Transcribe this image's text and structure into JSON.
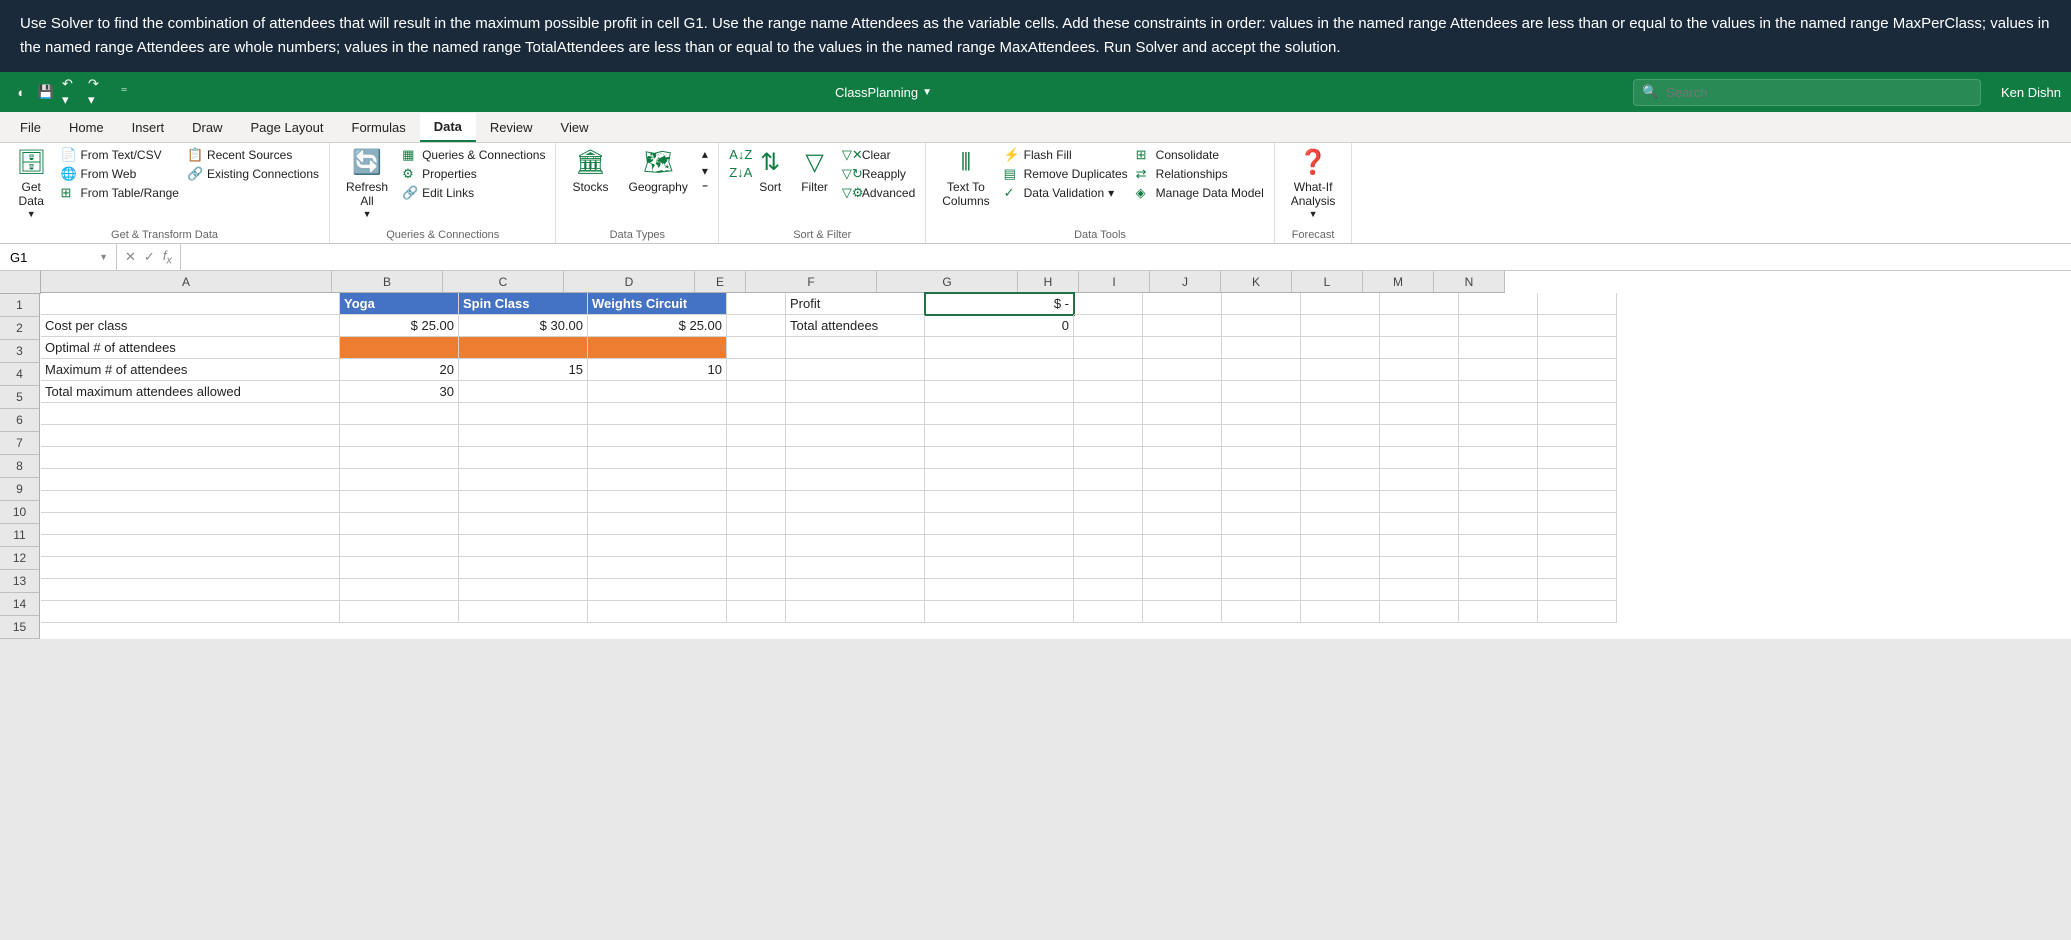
{
  "task_banner": {
    "text": "Use Solver to find the combination of attendees that will result in the maximum possible profit in cell G1.  Use the range name Attendees as the variable cells. Add these constraints in order: values in the named range Attendees are less than or equal to the values in the named range MaxPerClass; values in the named range Attendees are whole numbers; values in the named range TotalAttendees are less than or equal to the values in the named range MaxAttendees. Run Solver and accept the solution."
  },
  "titlebar": {
    "doc_name": "ClassPlanning",
    "search_placeholder": "Search",
    "user": "Ken Dishn"
  },
  "tabs": {
    "file": "File",
    "home": "Home",
    "insert": "Insert",
    "draw": "Draw",
    "pagelayout": "Page Layout",
    "formulas": "Formulas",
    "data": "Data",
    "review": "Review",
    "view": "View"
  },
  "ribbon": {
    "get_transform": {
      "get_data": "Get\nData",
      "text_csv": "From Text/CSV",
      "from_web": "From Web",
      "from_table": "From Table/Range",
      "recent": "Recent Sources",
      "existing": "Existing Connections",
      "label": "Get & Transform Data"
    },
    "queries": {
      "refresh": "Refresh\nAll",
      "qc": "Queries & Connections",
      "props": "Properties",
      "edit": "Edit Links",
      "label": "Queries & Connections"
    },
    "datatypes": {
      "stocks": "Stocks",
      "geo": "Geography",
      "label": "Data Types"
    },
    "sortfilter": {
      "sort": "Sort",
      "filter": "Filter",
      "clear": "Clear",
      "reapply": "Reapply",
      "advanced": "Advanced",
      "label": "Sort & Filter"
    },
    "datatools": {
      "ttc": "Text To\nColumns",
      "flash": "Flash Fill",
      "dup": "Remove Duplicates",
      "val": "Data Validation",
      "cons": "Consolidate",
      "rel": "Relationships",
      "mdm": "Manage Data Model",
      "label": "Data Tools"
    },
    "forecast": {
      "whatif": "What-If\nAnalysis",
      "label": "Forecast"
    }
  },
  "formula_bar": {
    "name_box": "G1",
    "formula": ""
  },
  "columns": [
    "A",
    "B",
    "C",
    "D",
    "E",
    "F",
    "G",
    "H",
    "I",
    "J",
    "K",
    "L",
    "M",
    "N"
  ],
  "rows": [
    "1",
    "2",
    "3",
    "4",
    "5",
    "6",
    "7",
    "8",
    "9",
    "10",
    "11",
    "12",
    "13",
    "14",
    "15"
  ],
  "sheet": {
    "r1": {
      "b": "Yoga",
      "c": "Spin Class",
      "d": "Weights Circuit",
      "f": "Profit",
      "g": "$                  -"
    },
    "r2": {
      "a": "Cost per class",
      "b": "$            25.00",
      "c": "$            30.00",
      "d": "$            25.00",
      "f": "Total attendees",
      "g": "0"
    },
    "r3": {
      "a": "Optimal # of attendees"
    },
    "r4": {
      "a": "Maximum # of attendees",
      "b": "20",
      "c": "15",
      "d": "10"
    },
    "r5": {
      "a": "Total maximum attendees allowed",
      "b": "30"
    }
  }
}
